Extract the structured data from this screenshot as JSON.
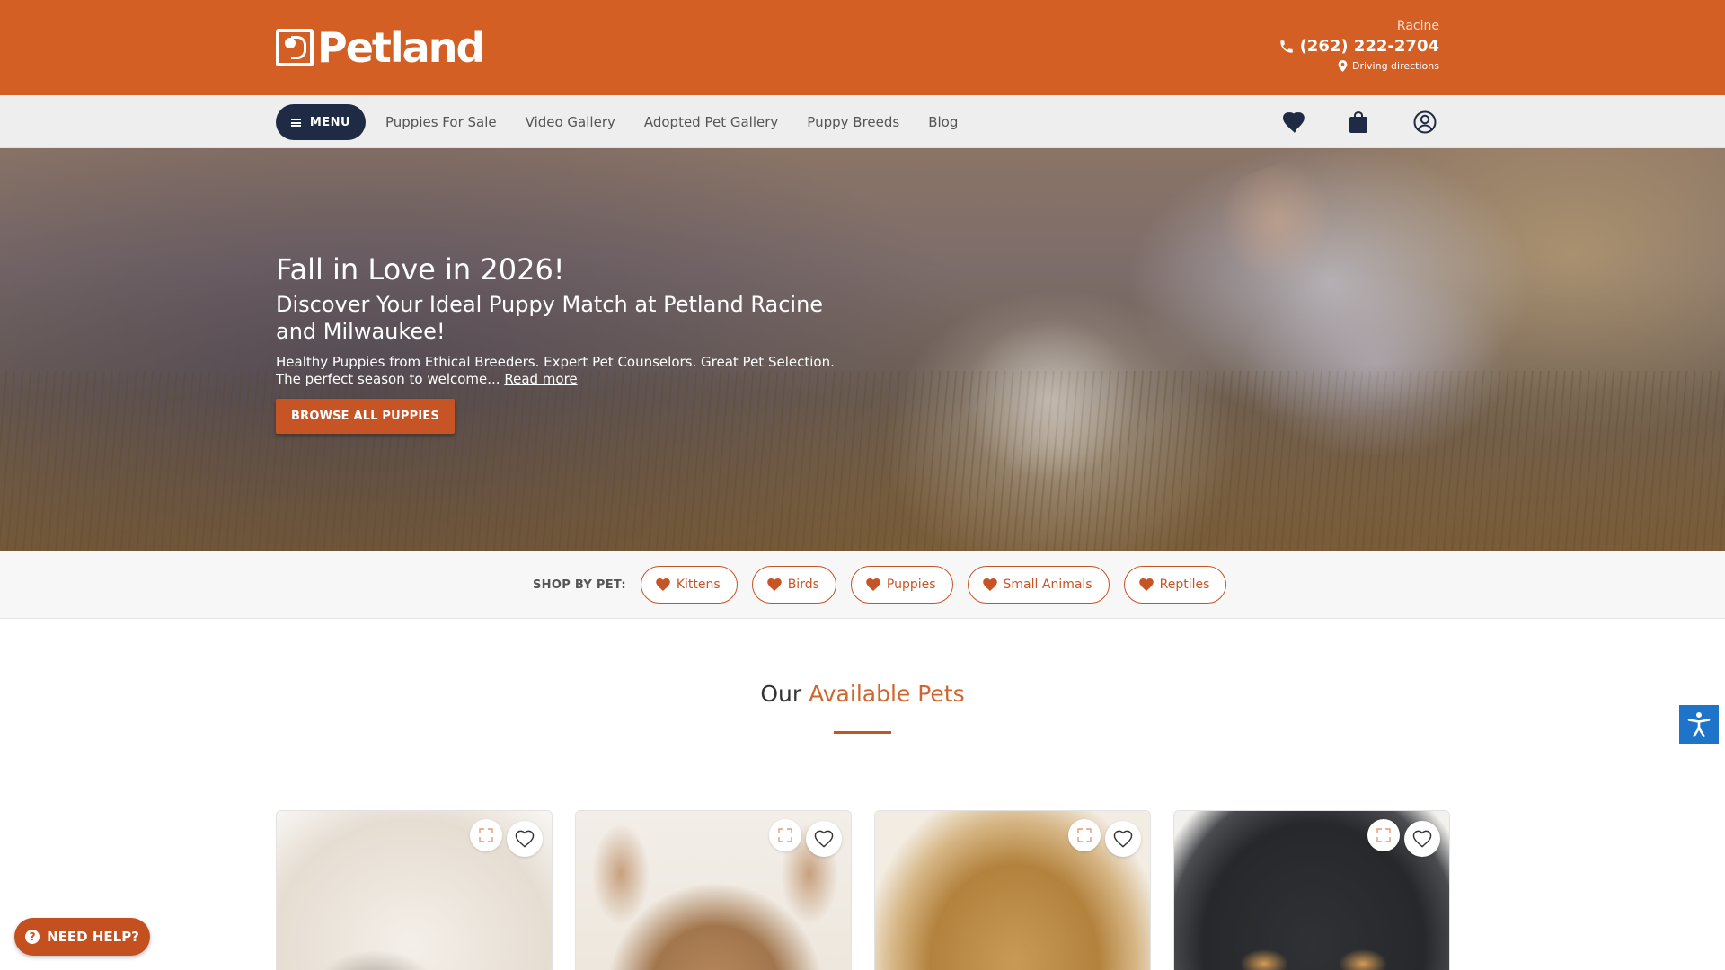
{
  "header": {
    "logo_text": "Petland",
    "store_name": "Racine",
    "phone": "(262) 222-2704",
    "directions_label": "Driving directions",
    "icons": {
      "phone": "phone-icon",
      "directions": "map-pin-icon"
    }
  },
  "nav": {
    "menu_label": "MENU",
    "links": [
      "Puppies For Sale",
      "Video Gallery",
      "Adopted Pet Gallery",
      "Puppy Breeds",
      "Blog"
    ],
    "icons": [
      "heart-icon",
      "shopping-bag-icon",
      "user-account-icon"
    ]
  },
  "hero": {
    "title": "Fall in Love in 2026!",
    "subtitle": "Discover Your Ideal Puppy Match at Petland Racine and Milwaukee!",
    "description": "Healthy Puppies from Ethical Breeders. Expert Pet Counselors. Great Pet Selection. The perfect season to welcome...",
    "read_more": "Read more",
    "cta": "BROWSE ALL PUPPIES"
  },
  "shop_by_pet": {
    "label": "SHOP BY PET:",
    "items": [
      "Kittens",
      "Birds",
      "Puppies",
      "Small Animals",
      "Reptiles"
    ]
  },
  "available": {
    "title_plain": "Our",
    "title_accent": "Available Pets",
    "cards": [
      {
        "image": "white fluffy puppy"
      },
      {
        "image": "tan large-eared puppy"
      },
      {
        "image": "golden fluffy puppy"
      },
      {
        "image": "black and tan curly puppy"
      }
    ]
  },
  "widgets": {
    "help_label": "NEED HELP?",
    "accessibility_icon": "accessibility-icon"
  },
  "colors": {
    "brand_orange": "#d45f25",
    "button_orange": "#c75424",
    "menu_navy": "#1f2a44",
    "accessibility_blue": "#1e74c8"
  }
}
